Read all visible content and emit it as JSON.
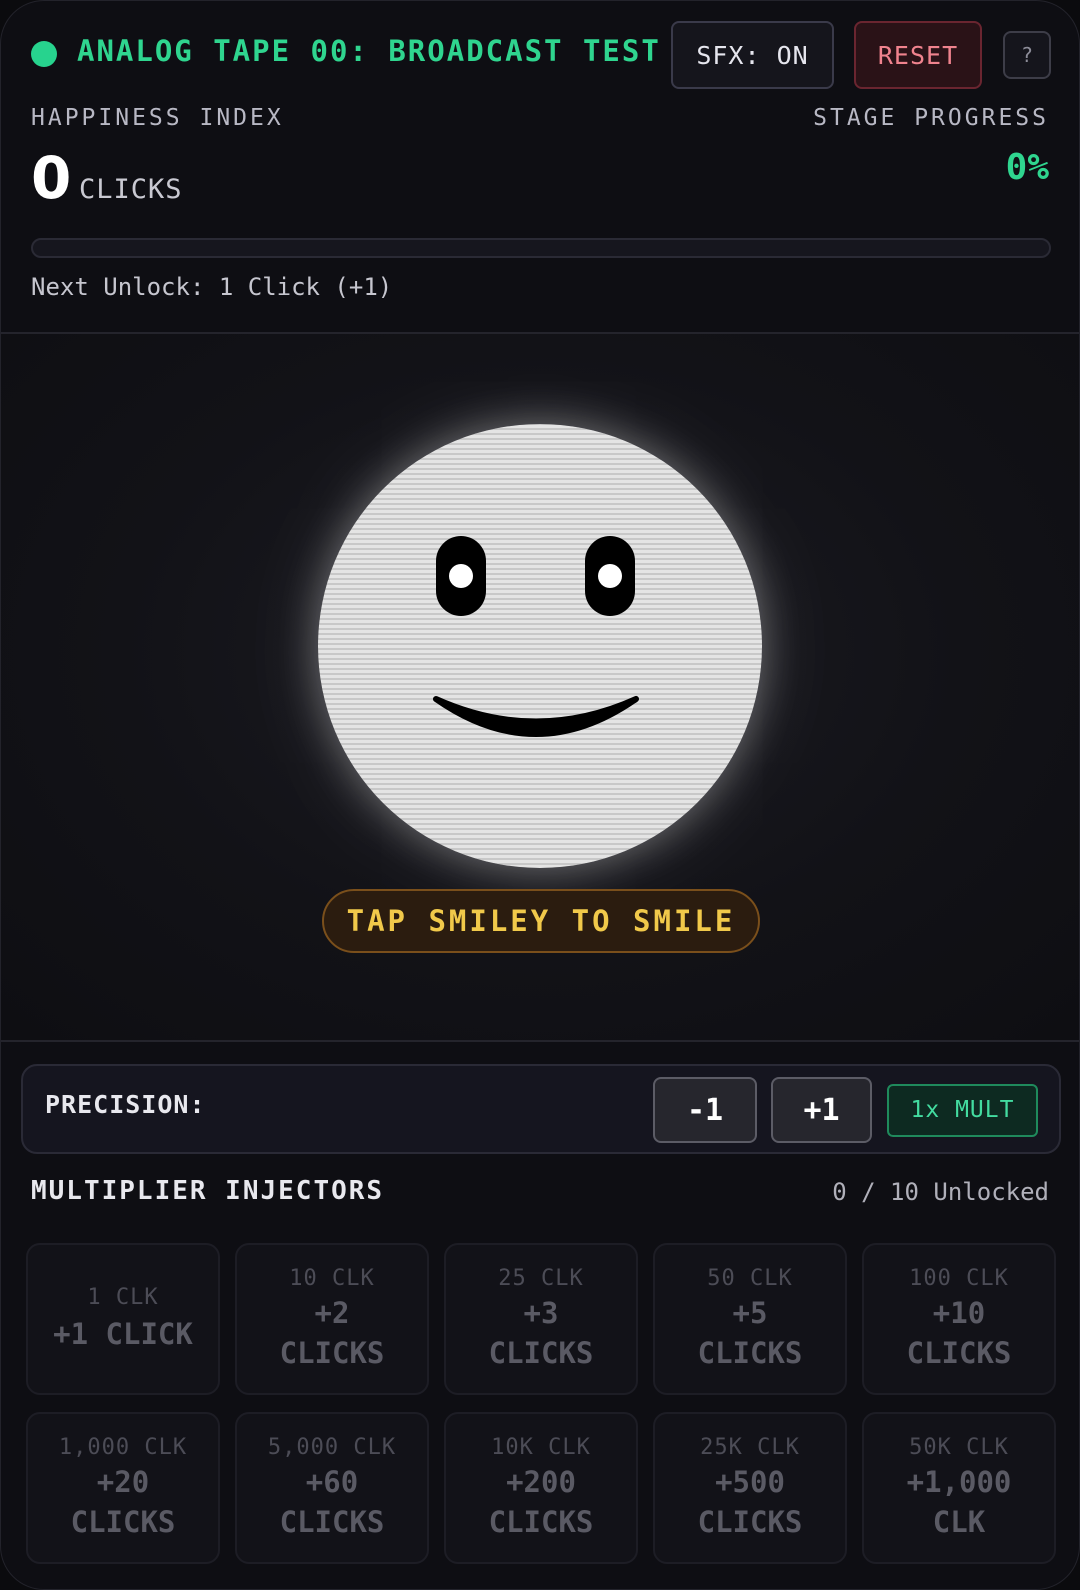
{
  "header": {
    "title": "ANALOG TAPE 00: BROADCAST TEST",
    "sfx_label": "SFX: ON",
    "reset_label": "RESET",
    "help_label": "?"
  },
  "stats": {
    "happiness_label": "HAPPINESS INDEX",
    "clicks_value": "0",
    "clicks_unit": "CLICKS",
    "progress_label": "STAGE PROGRESS",
    "progress_value": "0%",
    "progress_fraction": 0,
    "next_unlock": "Next Unlock: 1 Click (+1)"
  },
  "stage": {
    "smiley": "smiley-face",
    "hint": "TAP SMILEY TO SMILE"
  },
  "precision": {
    "label": "PRECISION:",
    "minus_label": "-1",
    "plus_label": "+1",
    "mult_label": "1x MULT"
  },
  "injectors": {
    "title": "MULTIPLIER INJECTORS",
    "unlocked": "0 / 10 Unlocked",
    "items": [
      {
        "cost": "1 CLK",
        "reward": "+1 CLICK",
        "unit": ""
      },
      {
        "cost": "10 CLK",
        "reward": "+2",
        "unit": "CLICKS"
      },
      {
        "cost": "25 CLK",
        "reward": "+3",
        "unit": "CLICKS"
      },
      {
        "cost": "50 CLK",
        "reward": "+5",
        "unit": "CLICKS"
      },
      {
        "cost": "100 CLK",
        "reward": "+10",
        "unit": "CLICKS"
      },
      {
        "cost": "1,000 CLK",
        "reward": "+20",
        "unit": "CLICKS"
      },
      {
        "cost": "5,000 CLK",
        "reward": "+60",
        "unit": "CLICKS"
      },
      {
        "cost": "10K CLK",
        "reward": "+200",
        "unit": "CLICKS"
      },
      {
        "cost": "25K CLK",
        "reward": "+500",
        "unit": "CLICKS"
      },
      {
        "cost": "50K CLK",
        "reward": "+1,000",
        "unit": "CLK"
      }
    ]
  },
  "colors": {
    "accent_green": "#2fd58f",
    "reset_red": "#f0838e",
    "hint_gold": "#f1c94a"
  }
}
